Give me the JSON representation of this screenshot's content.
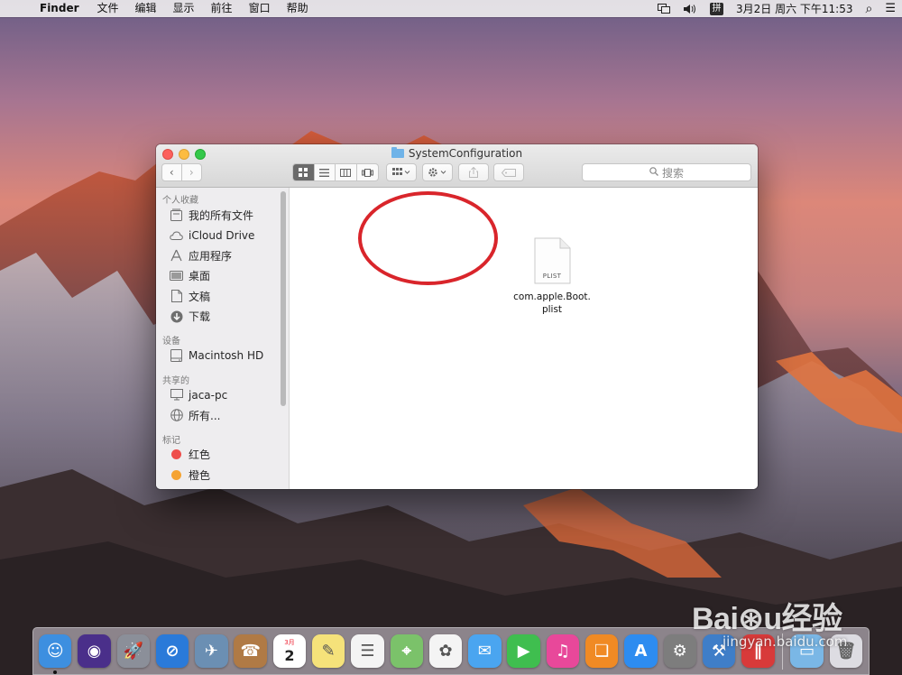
{
  "menubar": {
    "apple_glyph": "",
    "app_name": "Finder",
    "menus": [
      "文件",
      "编辑",
      "显示",
      "前往",
      "窗口",
      "帮助"
    ],
    "ime_label": "拼",
    "clock": "3月2日 周六 下午11:53",
    "search_glyph": "⌕",
    "list_glyph": "☰"
  },
  "window": {
    "title": "SystemConfiguration",
    "search_placeholder": "搜索",
    "nav_back": "‹",
    "nav_forward": "›"
  },
  "sidebar": {
    "favorites_header": "个人收藏",
    "favorites": [
      {
        "label": "我的所有文件",
        "icon": "all-files-icon"
      },
      {
        "label": "iCloud Drive",
        "icon": "cloud-icon"
      },
      {
        "label": "应用程序",
        "icon": "applications-icon"
      },
      {
        "label": "桌面",
        "icon": "desktop-icon"
      },
      {
        "label": "文稿",
        "icon": "documents-icon"
      },
      {
        "label": "下载",
        "icon": "downloads-icon"
      }
    ],
    "devices_header": "设备",
    "devices": [
      {
        "label": "Macintosh HD",
        "icon": "hard-drive-icon"
      }
    ],
    "shared_header": "共享的",
    "shared": [
      {
        "label": "jaca-pc",
        "icon": "pc-icon"
      },
      {
        "label": "所有...",
        "icon": "network-icon"
      }
    ],
    "tags_header": "标记",
    "tags": [
      {
        "label": "红色",
        "color": "#ee4e4b"
      },
      {
        "label": "橙色",
        "color": "#f5a332"
      }
    ]
  },
  "content": {
    "file": {
      "name": "com.apple.Boot.plist",
      "badge": "PLIST"
    },
    "annotation_color": "#d9252b"
  },
  "dock": {
    "apps": [
      {
        "name": "finder",
        "glyph": "☺",
        "color": "#3d8fe0",
        "running": true
      },
      {
        "name": "siri",
        "glyph": "◉",
        "color": "#4a2f8a"
      },
      {
        "name": "launchpad",
        "glyph": "🚀",
        "color": "#8b8f99"
      },
      {
        "name": "safari",
        "glyph": "⊘",
        "color": "#2a7ad9"
      },
      {
        "name": "mail-stamp",
        "glyph": "✈",
        "color": "#6b8fb3"
      },
      {
        "name": "contacts",
        "glyph": "☎",
        "color": "#b07a45"
      },
      {
        "name": "calendar",
        "glyph": "2",
        "color": "#ffffff"
      },
      {
        "name": "notes",
        "glyph": "✎",
        "color": "#f5e27a"
      },
      {
        "name": "reminders",
        "glyph": "☰",
        "color": "#f4f4f4"
      },
      {
        "name": "maps",
        "glyph": "⌖",
        "color": "#7bc26a"
      },
      {
        "name": "photos",
        "glyph": "✿",
        "color": "#f4f4f4"
      },
      {
        "name": "messages",
        "glyph": "✉",
        "color": "#4aa5f0"
      },
      {
        "name": "facetime",
        "glyph": "▶",
        "color": "#3fbe4f"
      },
      {
        "name": "itunes",
        "glyph": "♫",
        "color": "#e8489a"
      },
      {
        "name": "ibooks",
        "glyph": "❏",
        "color": "#f08a24"
      },
      {
        "name": "app-store",
        "glyph": "A",
        "color": "#2d8cf0"
      },
      {
        "name": "system-preferences",
        "glyph": "⚙",
        "color": "#7d7d7d"
      },
      {
        "name": "xcode",
        "glyph": "⚒",
        "color": "#3f7ec8"
      },
      {
        "name": "parallels",
        "glyph": "∥",
        "color": "#d83a3a"
      }
    ],
    "trash_glyph": "🗑",
    "folder_glyph": "▭",
    "calendar_month": "3月",
    "calendar_day": "2"
  },
  "watermark": {
    "logo": "Bai⊛u经验",
    "url": "jingyan.baidu.com"
  }
}
